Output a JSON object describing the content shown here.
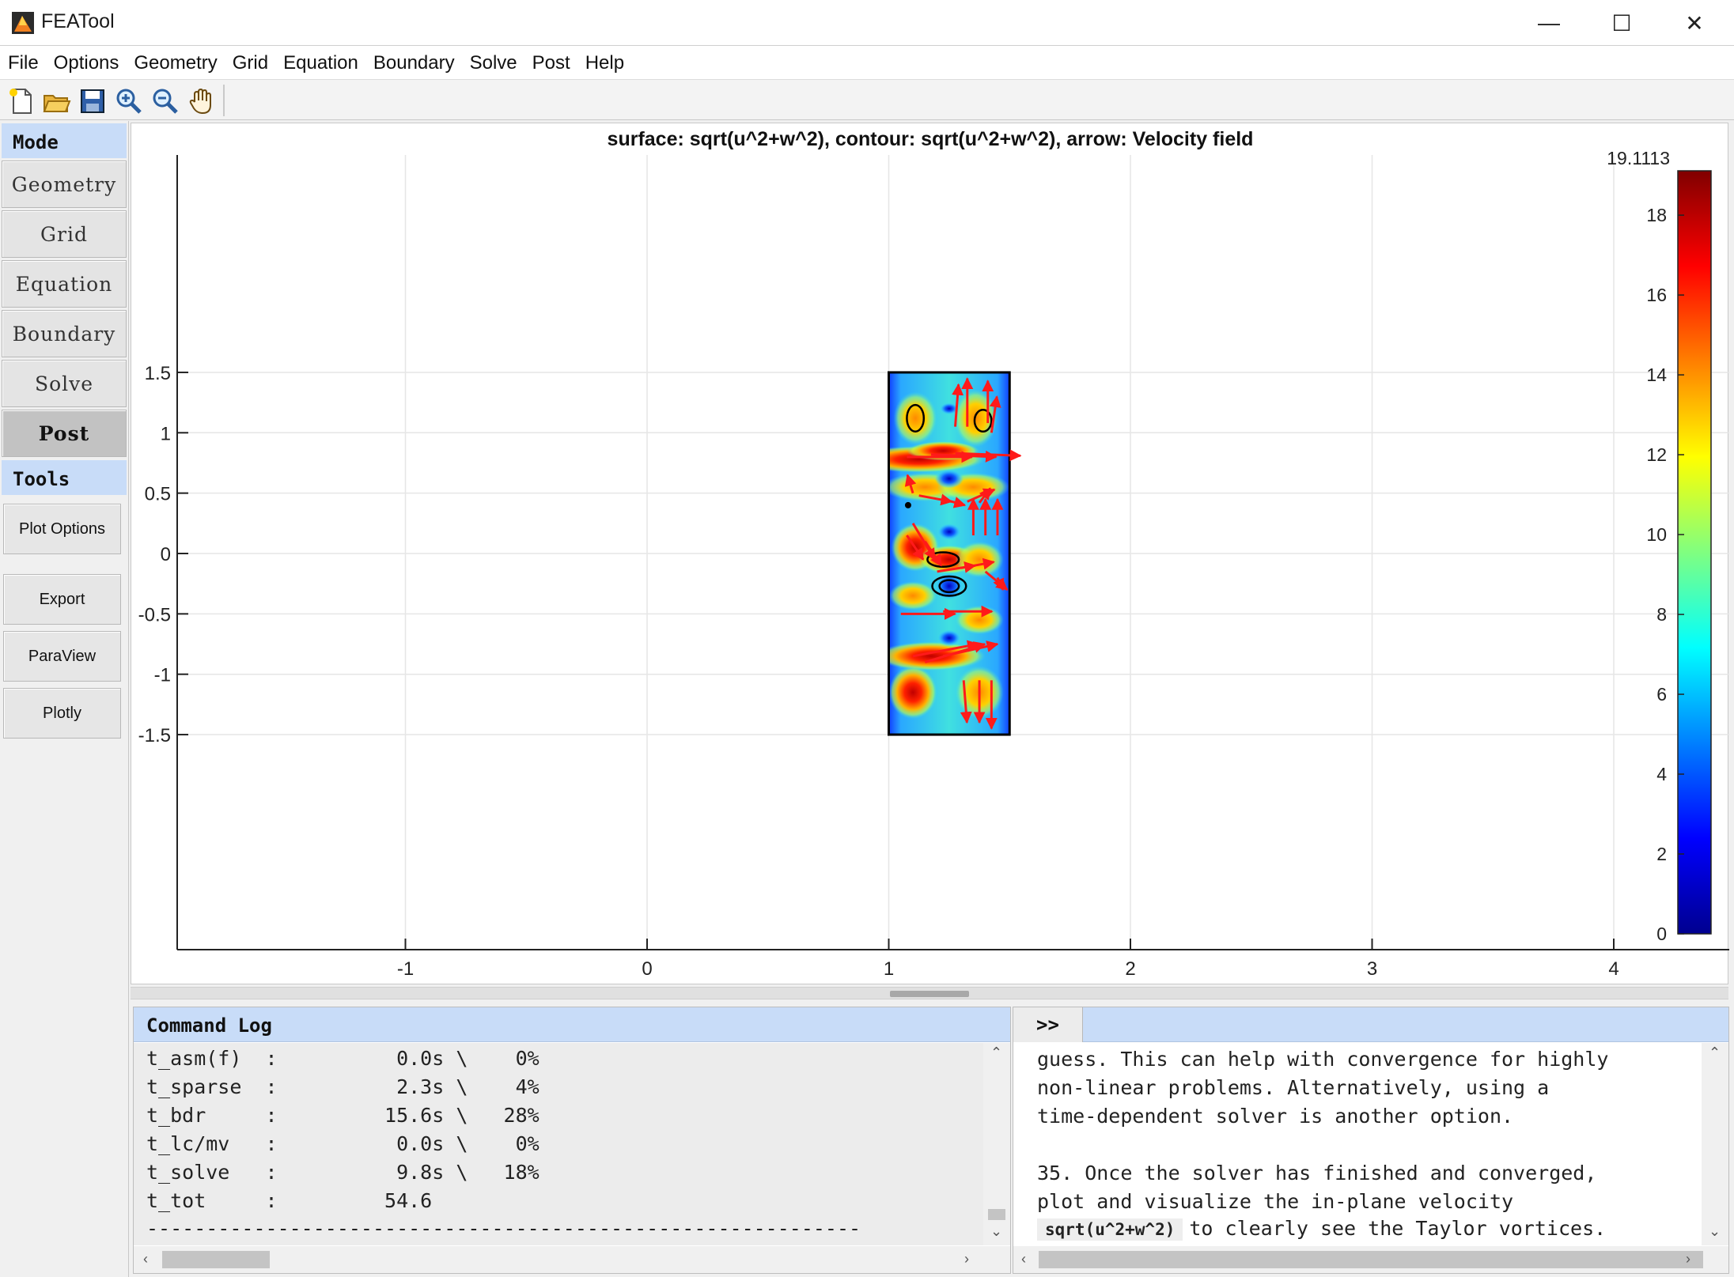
{
  "window": {
    "title": "FEATool",
    "minimize": "—",
    "maximize": "☐",
    "close": "✕"
  },
  "menu": [
    "File",
    "Options",
    "Geometry",
    "Grid",
    "Equation",
    "Boundary",
    "Solve",
    "Post",
    "Help"
  ],
  "toolbar": [
    "new-file-icon",
    "open-folder-icon",
    "save-icon",
    "zoom-in-icon",
    "zoom-out-icon",
    "pan-hand-icon"
  ],
  "sidebar": {
    "mode_header": "Mode",
    "modes": [
      "Geometry",
      "Grid",
      "Equation",
      "Boundary",
      "Solve",
      "Post"
    ],
    "active_mode": "Post",
    "tools_header": "Tools",
    "tools": [
      "Plot Options",
      "Export",
      "ParaView",
      "Plotly"
    ]
  },
  "plot": {
    "title": "surface: sqrt(u^2+w^2), contour: sqrt(u^2+w^2), arrow: Velocity field",
    "x_ticks": [
      "-1",
      "0",
      "1",
      "2",
      "3",
      "4"
    ],
    "y_ticks": [
      "1.5",
      "1",
      "0.5",
      "0",
      "-0.5",
      "-1",
      "-1.5"
    ],
    "colorbar_max": "19.1113",
    "colorbar_ticks": [
      "18",
      "16",
      "14",
      "12",
      "10",
      "8",
      "6",
      "4",
      "2",
      "0"
    ],
    "colors": {
      "arrows": "#ff1a1a",
      "contour": "#000000",
      "frame": "#000000"
    }
  },
  "chart_data": {
    "type": "heatmap",
    "title": "surface: sqrt(u^2+w^2), contour: sqrt(u^2+w^2), arrow: Velocity field",
    "xlim": [
      -1.9,
      4.5
    ],
    "ylim": [
      -1.65,
      1.65
    ],
    "domain": {
      "x": [
        1,
        1.5
      ],
      "y": [
        -1.5,
        1.5
      ]
    },
    "colormap": "jet",
    "colorbar": {
      "min": 0,
      "max": 19.1113,
      "ticks": [
        0,
        2,
        4,
        6,
        8,
        10,
        12,
        14,
        16,
        18
      ]
    },
    "x_ticks": [
      -1,
      0,
      1,
      2,
      3,
      4
    ],
    "y_ticks": [
      -1.5,
      -1,
      -0.5,
      0,
      0.5,
      1,
      1.5
    ],
    "grid": true
  },
  "log": {
    "header": "Command Log",
    "lines": [
      "t_asm(f)  :          0.0s \\    0%",
      "t_sparse  :          2.3s \\    4%",
      "t_bdr     :         15.6s \\   28%",
      "t_lc/mv   :          0.0s \\    0%",
      "t_solve   :          9.8s \\   18%",
      "t_tot     :         54.6",
      "------------------------------------------------------------"
    ]
  },
  "help": {
    "toggle": ">>",
    "lines": [
      "guess. This can help with convergence for highly",
      "non-linear problems. Alternatively, using a",
      "time-dependent solver is another option.",
      "",
      "35. Once the solver has finished and converged,",
      "plot and visualize the in-plane velocity"
    ],
    "code": "sqrt(u^2+w^2)",
    "last_line": "to clearly see the Taylor vortices."
  }
}
